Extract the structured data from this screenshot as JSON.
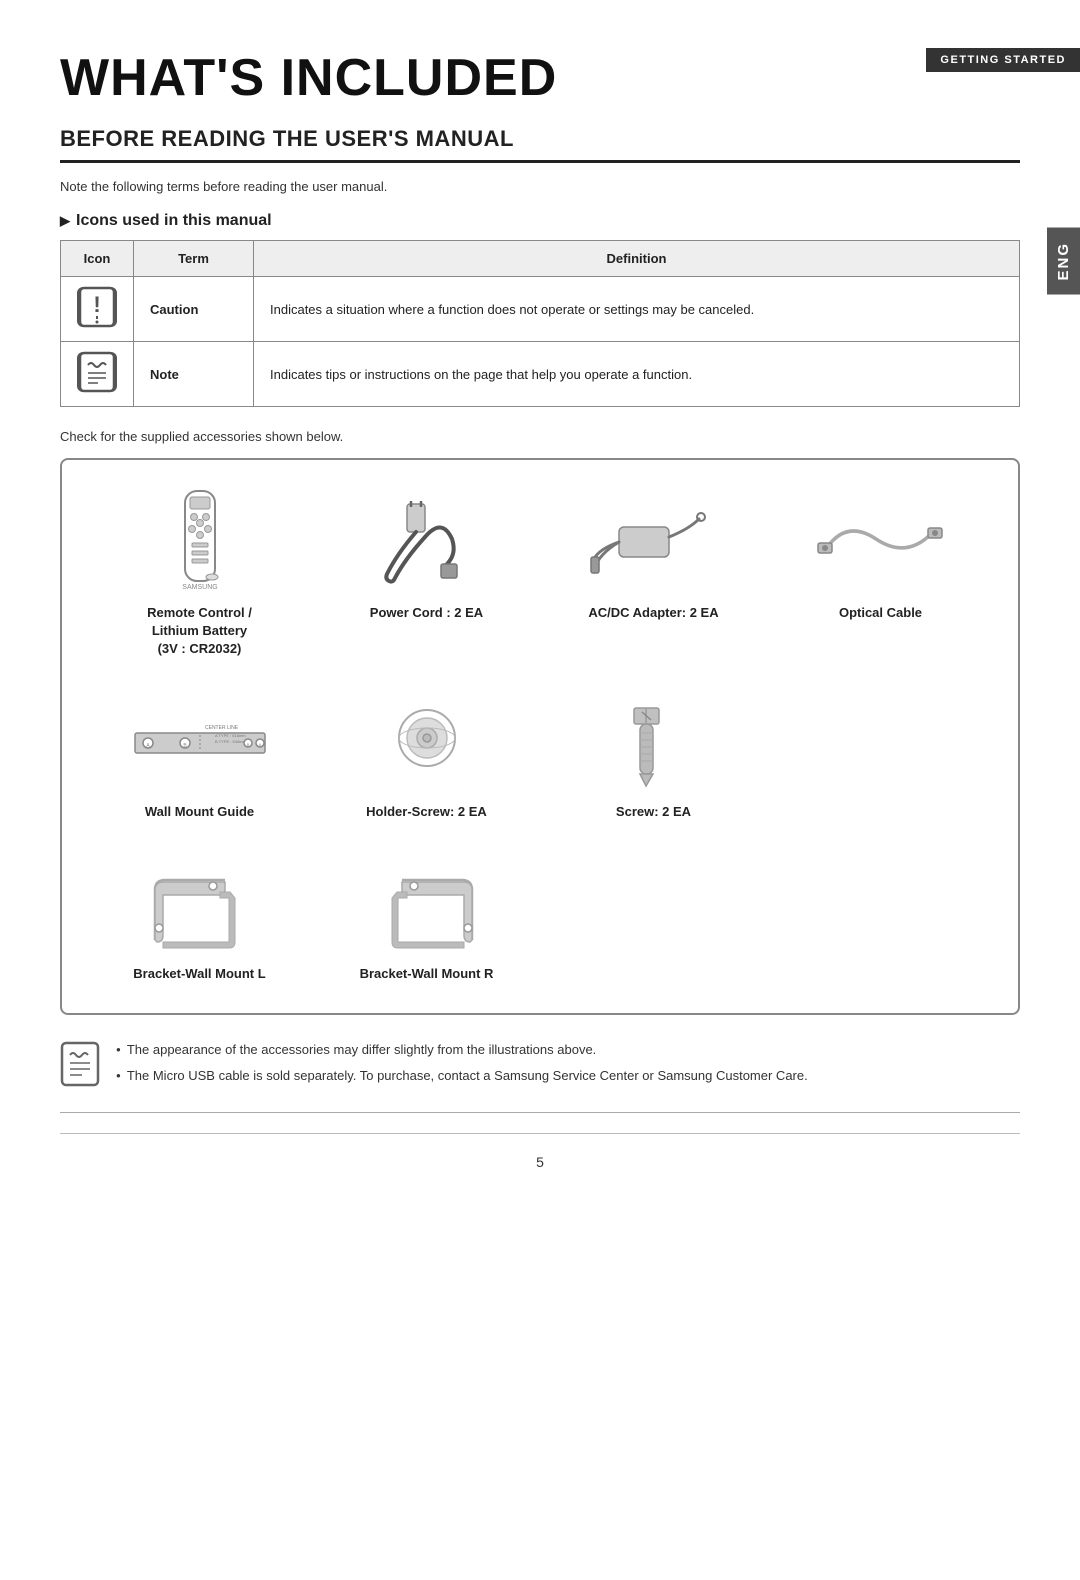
{
  "header": {
    "top_label": "GETTING STARTED",
    "lang_tab": "ENG"
  },
  "page": {
    "title": "WHAT'S INCLUDED",
    "section_title": "BEFORE READING THE USER'S MANUAL",
    "intro_text": "Note the following terms before reading the user manual.",
    "icons_heading": "Icons used in this manual",
    "icons_table": {
      "headers": [
        "Icon",
        "Term",
        "Definition"
      ],
      "rows": [
        {
          "icon": "caution",
          "term": "Caution",
          "definition": "Indicates a situation where a function does not operate or settings may be canceled."
        },
        {
          "icon": "note",
          "term": "Note",
          "definition": "Indicates tips or instructions on the page that help you operate a function."
        }
      ]
    },
    "check_text": "Check for the supplied accessories shown below.",
    "accessories": [
      {
        "id": "remote-control",
        "label": "Remote Control /\nLithium Battery\n(3V : CR2032)"
      },
      {
        "id": "power-cord",
        "label": "Power Cord : 2 EA"
      },
      {
        "id": "acdc-adapter",
        "label": "AC/DC Adapter: 2 EA"
      },
      {
        "id": "optical-cable",
        "label": "Optical Cable"
      },
      {
        "id": "wall-mount-guide",
        "label": "Wall Mount Guide"
      },
      {
        "id": "holder-screw",
        "label": "Holder-Screw: 2 EA"
      },
      {
        "id": "screw",
        "label": "Screw: 2 EA"
      },
      {
        "id": "bracket-wall-mount-l",
        "label": "Bracket-Wall Mount L"
      },
      {
        "id": "bracket-wall-mount-r",
        "label": "Bracket-Wall Mount R"
      }
    ],
    "notes": [
      "The appearance of the accessories may differ slightly from the illustrations above.",
      "The Micro USB cable is sold separately. To purchase, contact a Samsung Service Center or Samsung Customer Care."
    ],
    "page_number": "5"
  }
}
